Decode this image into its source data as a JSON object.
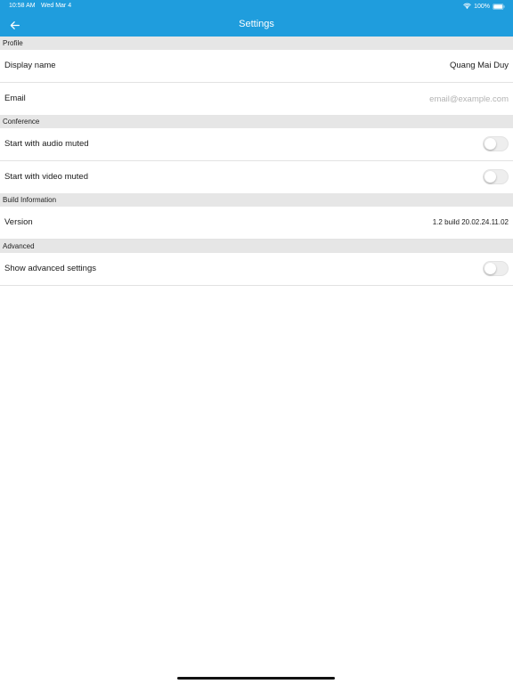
{
  "status_bar": {
    "time": "10:58 AM",
    "date": "Wed Mar 4",
    "battery": "100%"
  },
  "nav": {
    "title": "Settings",
    "back_icon": "arrow-left-icon"
  },
  "colors": {
    "header_bg": "#1f9ddd",
    "section_bg": "#e6e6e6",
    "placeholder": "#b3b3b3"
  },
  "sections": {
    "profile": {
      "header": "Profile",
      "display_name_label": "Display name",
      "display_name_value": "Quang Mai Duy",
      "email_label": "Email",
      "email_value": "",
      "email_placeholder": "email@example.com"
    },
    "conference": {
      "header": "Conference",
      "audio_muted_label": "Start with audio muted",
      "audio_muted_on": false,
      "video_muted_label": "Start with video muted",
      "video_muted_on": false
    },
    "build": {
      "header": "Build Information",
      "version_label": "Version",
      "version_value": "1.2 build 20.02.24.11.02"
    },
    "advanced": {
      "header": "Advanced",
      "show_advanced_label": "Show advanced settings",
      "show_advanced_on": false
    }
  }
}
